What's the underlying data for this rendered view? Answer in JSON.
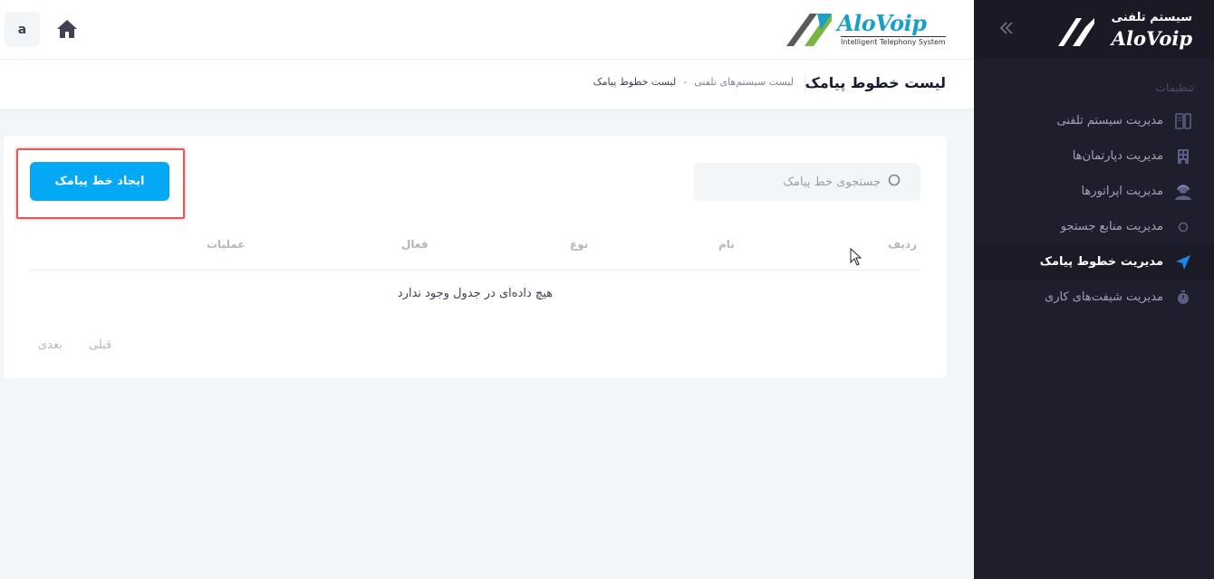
{
  "header": {
    "user_initial": "a",
    "logo_brand": "AloVoip",
    "logo_tagline": "Intelligent Telephony System"
  },
  "sidebar": {
    "logo_title": "سیستم تلفنی",
    "logo_brand": "AloVoip",
    "section_label": "تنظیمات",
    "items": [
      {
        "label": "مدیریت سیستم تلفنی",
        "icon": "phone-system-icon"
      },
      {
        "label": "مدیریت دپارتمان‌ها",
        "icon": "building-icon"
      },
      {
        "label": "مدیریت اپراتورها",
        "icon": "operator-icon"
      },
      {
        "label": "مدیریت منابع جستجو",
        "icon": "circle-icon"
      },
      {
        "label": "مدیریت خطوط پیامک",
        "icon": "send-icon",
        "active": true
      },
      {
        "label": "مدیریت شیفت‌های کاری",
        "icon": "stopwatch-icon"
      }
    ]
  },
  "subheader": {
    "title": "لیست خطوط پیامک",
    "breadcrumb": [
      "لیست سیستم‌های تلفنی",
      "لیست خطوط پیامک"
    ],
    "separator": "-"
  },
  "card": {
    "search_placeholder": "جستجوی خط پیامک",
    "create_button": "ایجاد خط پیامک",
    "columns": [
      "ردیف",
      "نام",
      "نوع",
      "فعال",
      "عملیات"
    ],
    "empty_message": "هیچ داده‌ای در جدول وجود ندارد",
    "pagination": {
      "prev": "قبلی",
      "next": "بعدی"
    }
  },
  "colors": {
    "primary": "#03a9f4",
    "sidebar_bg": "#1e1e2d",
    "active_icon": "#1e88e5",
    "highlight": "#e05a5a"
  }
}
